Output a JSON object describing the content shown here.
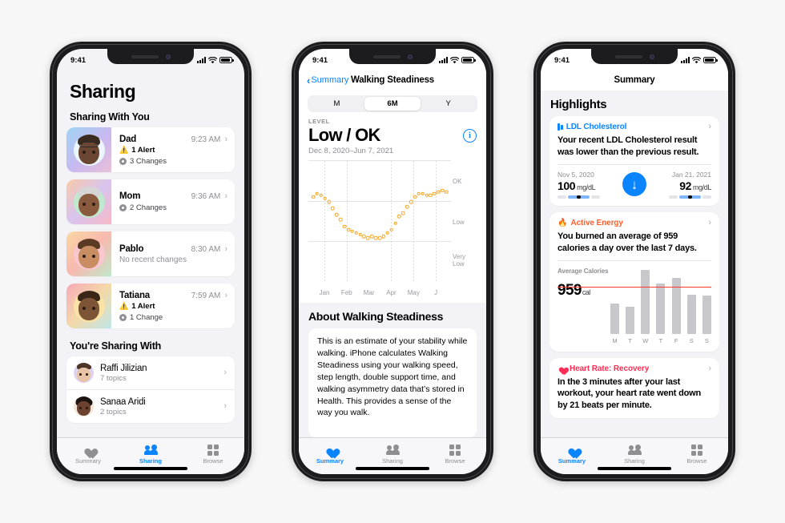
{
  "status_bar": {
    "time": "9:41"
  },
  "phone1": {
    "title": "Sharing",
    "section_shared_with_you": "Sharing With You",
    "section_youre_sharing": "You're Sharing With",
    "contacts": [
      {
        "name": "Dad",
        "time": "9:23 AM",
        "alert": "1 Alert",
        "changes": "3 Changes",
        "has_alert": true
      },
      {
        "name": "Mom",
        "time": "9:36 AM",
        "alert": "",
        "changes": "2 Changes",
        "has_alert": false
      },
      {
        "name": "Pablo",
        "time": "8:30 AM",
        "alert": "",
        "changes": "",
        "no_changes": "No recent changes",
        "has_alert": false
      },
      {
        "name": "Tatiana",
        "time": "7:59 AM",
        "alert": "1 Alert",
        "changes": "1 Change",
        "has_alert": true
      }
    ],
    "sharing_with": [
      {
        "name": "Raffi Jilizian",
        "topics": "7 topics"
      },
      {
        "name": "Sanaa Aridi",
        "topics": "2 topics"
      }
    ],
    "tabs": [
      {
        "label": "Summary",
        "icon": "heart-icon",
        "active": false
      },
      {
        "label": "Sharing",
        "icon": "people-icon",
        "active": true
      },
      {
        "label": "Browse",
        "icon": "grid-icon",
        "active": false
      }
    ]
  },
  "phone2": {
    "back_label": "Summary",
    "nav_title": "Walking Steadiness",
    "segments": [
      {
        "label": "M",
        "selected": false
      },
      {
        "label": "6M",
        "selected": true
      },
      {
        "label": "Y",
        "selected": false
      }
    ],
    "level_caption": "LEVEL",
    "level_value": "Low / OK",
    "date_range": "Dec 8, 2020–Jun 7, 2021",
    "info_icon": "i",
    "about_heading": "About Walking Steadiness",
    "about_text": "This is an estimate of your stability while walking. iPhone calculates Walking Steadiness using your walking speed, step length, double support time, and walking asymmetry data that’s stored in Health. This provides a sense of the way you walk.",
    "tabs": [
      {
        "label": "Summary",
        "icon": "heart-icon",
        "active": true
      },
      {
        "label": "Sharing",
        "icon": "people-icon",
        "active": false
      },
      {
        "label": "Browse",
        "icon": "grid-icon",
        "active": false
      }
    ]
  },
  "phone3": {
    "nav_title": "Summary",
    "highlights_heading": "Highlights",
    "cards": [
      {
        "kind": "LDL Cholesterol",
        "kind_color": "#0a84ff",
        "icon": "bar-chart-icon",
        "description": "Your recent LDL Cholesterol result was lower than the previous result.",
        "left_date": "Nov 5, 2020",
        "left_value": "100",
        "left_unit": "mg/dL",
        "right_date": "Jan 21, 2021",
        "right_value": "92",
        "right_unit": "mg/dL",
        "trend_arrow": "↓"
      },
      {
        "kind": "Active Energy",
        "kind_color": "#ff5e2c",
        "icon": "flame-icon",
        "description": "You burned an average of 959 calories a day over the last 7 days.",
        "chart_caption": "Average Calories",
        "avg_value": "959",
        "avg_unit": "cal"
      },
      {
        "kind": "Heart Rate: Recovery",
        "kind_color": "#ff2d55",
        "icon": "heart-icon",
        "description": "In the 3 minutes after your last workout, your heart rate went down by 21 beats per minute."
      }
    ],
    "tabs": [
      {
        "label": "Summary",
        "icon": "heart-icon",
        "active": true
      },
      {
        "label": "Sharing",
        "icon": "people-icon",
        "active": false
      },
      {
        "label": "Browse",
        "icon": "grid-icon",
        "active": false
      }
    ]
  },
  "chart_data": [
    {
      "type": "scatter",
      "title": "Walking Steadiness",
      "subtitle": "Low / OK",
      "xlabel": "",
      "ylabel": "",
      "x_tick_labels": [
        "Jan",
        "Feb",
        "Mar",
        "Apr",
        "May",
        "J"
      ],
      "y_tick_labels": [
        "OK",
        "Low",
        "Very Low"
      ],
      "ylim": [
        0,
        100
      ],
      "grid": true,
      "point_color": "#f5a623",
      "range": "Dec 8, 2020–Jun 7, 2021",
      "x": [
        0,
        1,
        2,
        3,
        4,
        5,
        6,
        7,
        8,
        9,
        10,
        11,
        12,
        13,
        14,
        15,
        16,
        17,
        18,
        19,
        20,
        21,
        22,
        23,
        24,
        25,
        26,
        27,
        28,
        29,
        30,
        31,
        32,
        33,
        34
      ],
      "values": [
        76,
        78,
        77,
        75,
        73,
        69,
        65,
        62,
        58,
        56,
        55,
        54,
        53,
        52,
        51,
        52,
        51,
        51,
        52,
        54,
        56,
        60,
        64,
        66,
        70,
        73,
        76,
        78,
        78,
        77,
        77,
        78,
        79,
        80,
        79
      ]
    },
    {
      "type": "bar",
      "title": "Average Calories",
      "categories": [
        "M",
        "T",
        "W",
        "T",
        "F",
        "S",
        "S"
      ],
      "values": [
        620,
        540,
        1290,
        1010,
        1130,
        790,
        780
      ],
      "average": 959,
      "average_label": "959",
      "unit": "cal",
      "bar_color": "#c7c7cc",
      "average_line_color": "#ff3b30",
      "xlabel": "",
      "ylabel": "",
      "grid": false
    }
  ]
}
